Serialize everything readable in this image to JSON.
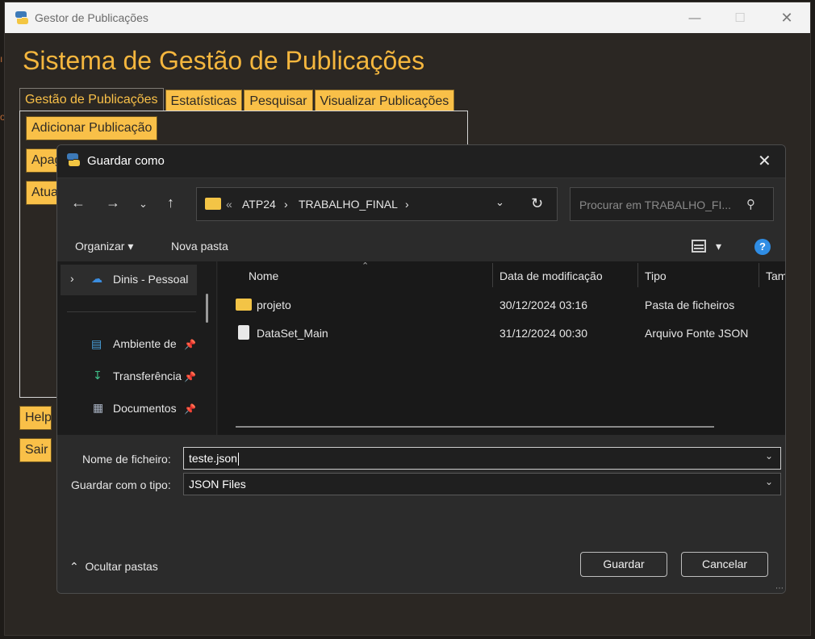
{
  "main_window": {
    "title": "Gestor de Publicações",
    "app_title": "Sistema de Gestão de Publicações",
    "tabs": [
      {
        "label": "Gestão de Publicações",
        "active": true
      },
      {
        "label": "Estatísticas",
        "active": false
      },
      {
        "label": "Pesquisar",
        "active": false
      },
      {
        "label": "Visualizar Publicações",
        "active": false
      }
    ],
    "buttons": {
      "adicionar": "Adicionar Publicação",
      "apagar": "Apag",
      "atualizar": "Atua",
      "help": "Help",
      "sair": "Sair"
    },
    "accent_color": "#f9c048"
  },
  "dialog": {
    "title": "Guardar como",
    "path": [
      "ATP24",
      "TRABALHO_FINAL"
    ],
    "path_overflow": "«",
    "search_placeholder": "Procurar em TRABALHO_FI...",
    "toolbar": {
      "organize": "Organizar",
      "new_folder": "Nova pasta"
    },
    "sidebar": {
      "account": "Dinis - Pessoal",
      "items": [
        "Ambiente de",
        "Transferência",
        "Documentos"
      ]
    },
    "columns": [
      "Nome",
      "Data de modificação",
      "Tipo",
      "Tam"
    ],
    "files": [
      {
        "name": "projeto",
        "modified": "30/12/2024 03:16",
        "type": "Pasta de ficheiros",
        "icon": "folder-icon"
      },
      {
        "name": "DataSet_Main",
        "modified": "31/12/2024 00:30",
        "type": "Arquivo Fonte JSON",
        "icon": "json-file-icon"
      }
    ],
    "filename_label": "Nome de ficheiro:",
    "filename_value": "teste.json",
    "filetype_label": "Guardar com o tipo:",
    "filetype_value": "JSON Files",
    "hide_folders": "Ocultar pastas",
    "save_button": "Guardar",
    "cancel_button": "Cancelar"
  }
}
